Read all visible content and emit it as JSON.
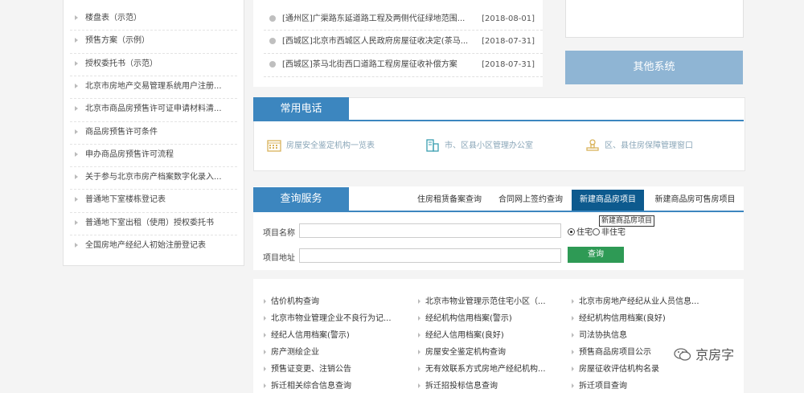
{
  "sidebar": {
    "items": [
      {
        "label": "楼盘表（示范）"
      },
      {
        "label": "预售方案（示例）"
      },
      {
        "label": "授权委托书（示范）"
      },
      {
        "label": "北京市房地产交易管理系统用户注册..."
      },
      {
        "label": "北京市商品房预售许可证申请材料清..."
      },
      {
        "label": "商品房预售许可条件"
      },
      {
        "label": "申办商品房预售许可流程"
      },
      {
        "label": "关于参与北京市房产档案数字化录入..."
      },
      {
        "label": "普通地下室楼栋登记表"
      },
      {
        "label": "普通地下室出租（使用）授权委托书"
      },
      {
        "label": "全国房地产经纪人初始注册登记表"
      }
    ]
  },
  "news": {
    "items": [
      {
        "title": "[通州区]广渠路东延道路工程及两侧代征绿地范围...",
        "date": "[2018-08-01]"
      },
      {
        "title": "[西城区]北京市西城区人民政府房屋征收决定(茶马...",
        "date": "[2018-07-31]"
      },
      {
        "title": "[西城区]茶马北街西口道路工程房屋征收补偿方案",
        "date": "[2018-07-31]"
      }
    ]
  },
  "right": {
    "other_systems": "其他系统"
  },
  "phones": {
    "title": "常用电话",
    "items": [
      {
        "label": "房屋安全鉴定机构一览表",
        "icon": "calendar-icon"
      },
      {
        "label": "市、区县小区管理办公室",
        "icon": "building-icon"
      },
      {
        "label": "区、县住房保障管理窗口",
        "icon": "stamp-icon"
      }
    ]
  },
  "query": {
    "title": "查询服务",
    "tabs": [
      {
        "label": "住房租赁备案查询"
      },
      {
        "label": "合同网上签约查询"
      },
      {
        "label": "新建商品房项目"
      },
      {
        "label": "新建商品房可售房项目"
      }
    ],
    "tooltip": "新建商品房项目",
    "name_label": "项目名称",
    "address_label": "项目地址",
    "name_value": "",
    "address_value": "",
    "radio_residential": "住宅",
    "radio_non_residential": "非住宅",
    "button": "查询"
  },
  "links": {
    "col1": [
      "估价机构查询",
      "北京市物业管理企业不良行为记...",
      "经纪人信用档案(警示)",
      "房产测绘企业",
      "预售证变更、注销公告",
      "拆迁相关综合信息查询"
    ],
    "col2": [
      "北京市物业管理示范住宅小区（...",
      "经纪机构信用档案(警示)",
      "经纪人信用档案(良好)",
      "房屋安全鉴定机构查询",
      "无有效联系方式房地产经纪机构...",
      "拆迁招投标信息查询"
    ],
    "col3": [
      "北京市房地产经纪从业人员信息...",
      "经纪机构信用档案(良好)",
      "司法协执信息",
      "预售商品房项目公示",
      "房屋征收评估机构名录",
      "拆迁项目查询"
    ]
  },
  "watermark": "京房字"
}
